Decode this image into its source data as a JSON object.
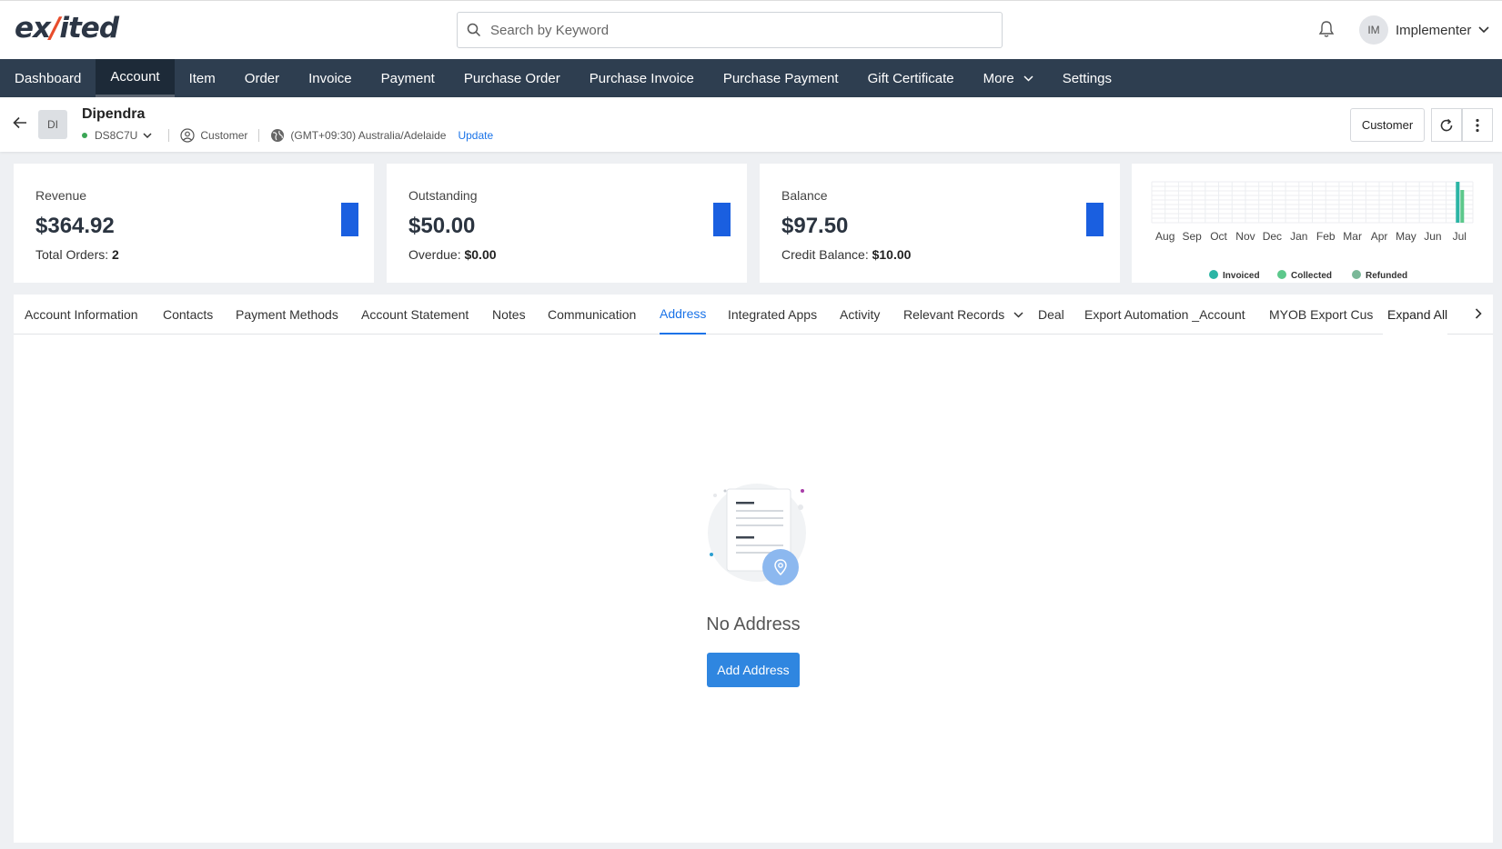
{
  "app": {
    "logo_pre": "ex",
    "logo_slash": "/",
    "logo_post": "ited"
  },
  "search": {
    "placeholder": "Search by Keyword",
    "value": ""
  },
  "user": {
    "initials": "IM",
    "name": "Implementer"
  },
  "nav": {
    "items": [
      {
        "label": "Dashboard"
      },
      {
        "label": "Account",
        "active": true
      },
      {
        "label": "Item"
      },
      {
        "label": "Order"
      },
      {
        "label": "Invoice"
      },
      {
        "label": "Payment"
      },
      {
        "label": "Purchase Order"
      },
      {
        "label": "Purchase Invoice"
      },
      {
        "label": "Purchase Payment"
      },
      {
        "label": "Gift Certificate"
      },
      {
        "label": "More"
      },
      {
        "label": "Settings"
      }
    ]
  },
  "account": {
    "initials": "DI",
    "name": "Dipendra",
    "code": "DS8C7U",
    "type": "Customer",
    "timezone": "(GMT+09:30) Australia/Adelaide",
    "update_label": "Update",
    "status_color": "#3aa655",
    "type_button": "Customer"
  },
  "cards": {
    "revenue": {
      "label": "Revenue",
      "value": "$364.92",
      "sub_label": "Total Orders:",
      "sub_value": "2"
    },
    "outstanding": {
      "label": "Outstanding",
      "value": "$50.00",
      "sub_label": "Overdue:",
      "sub_value": "$0.00"
    },
    "balance": {
      "label": "Balance",
      "value": "$97.50",
      "sub_label": "Credit Balance:",
      "sub_value": "$10.00"
    },
    "bar_color": "#1a5fe0"
  },
  "chart_data": {
    "type": "bar",
    "categories": [
      "Aug",
      "Sep",
      "Oct",
      "Nov",
      "Dec",
      "Jan",
      "Feb",
      "Mar",
      "Apr",
      "May",
      "Jun",
      "Jul"
    ],
    "series": [
      {
        "name": "Invoiced",
        "color": "#2bb5a5",
        "values": [
          0,
          0,
          0,
          0,
          0,
          0,
          0,
          0,
          0,
          0,
          0,
          1.0
        ]
      },
      {
        "name": "Collected",
        "color": "#5cc88b",
        "values": [
          0,
          0,
          0,
          0,
          0,
          0,
          0,
          0,
          0,
          0,
          0,
          0.8
        ]
      },
      {
        "name": "Refunded",
        "color": "#7ab898",
        "values": [
          0,
          0,
          0,
          0,
          0,
          0,
          0,
          0,
          0,
          0,
          0,
          0
        ]
      }
    ],
    "grid": true,
    "legend": "bottom"
  },
  "tabs": {
    "items": [
      {
        "label": "Account Information"
      },
      {
        "label": "Contacts"
      },
      {
        "label": "Payment Methods"
      },
      {
        "label": "Account Statement"
      },
      {
        "label": "Notes"
      },
      {
        "label": "Communication"
      },
      {
        "label": "Address",
        "active": true
      },
      {
        "label": "Integrated Apps"
      },
      {
        "label": "Activity"
      },
      {
        "label": "Relevant Records"
      },
      {
        "label": "Deal"
      },
      {
        "label": "Export Automation _Account"
      },
      {
        "label": "MYOB Export Cus"
      }
    ],
    "expand_all": "Expand All"
  },
  "empty_state": {
    "title": "No Address",
    "button": "Add Address"
  }
}
